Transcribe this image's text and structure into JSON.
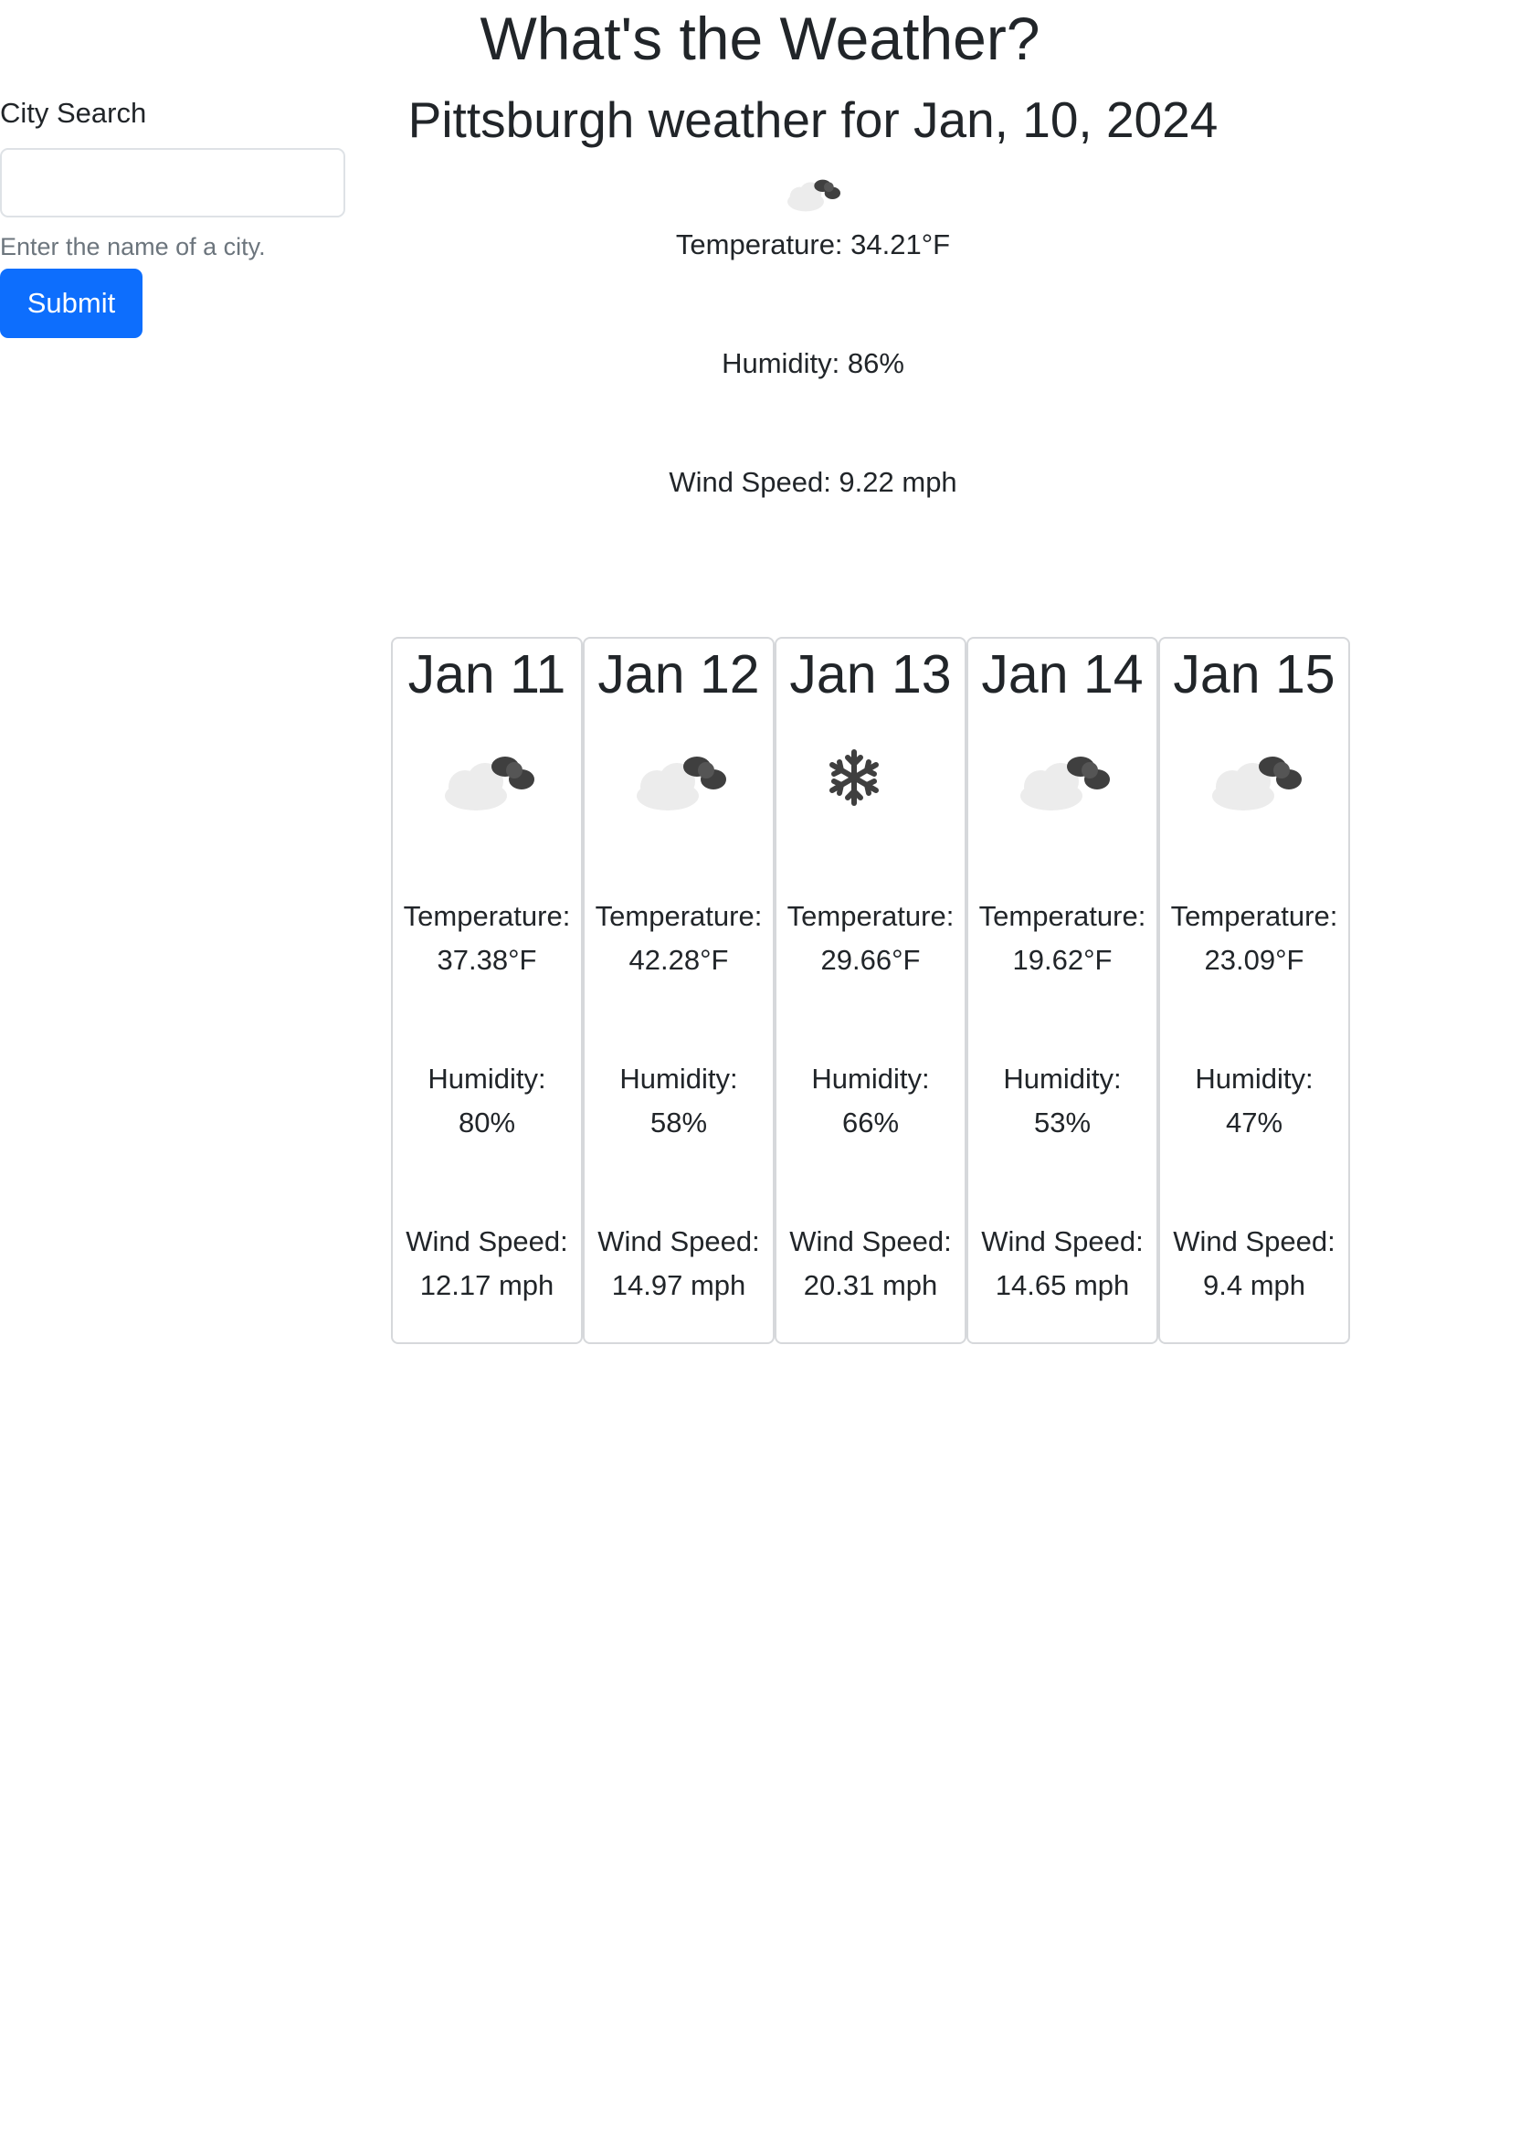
{
  "header": {
    "title": "What's the Weather?"
  },
  "search": {
    "label": "City Search",
    "value": "",
    "placeholder": "",
    "help": "Enter the name of a city.",
    "submit_label": "Submit"
  },
  "current": {
    "title": "Pittsburgh weather for Jan, 10, 2024",
    "icon": "cloudy-icon",
    "temperature": "Temperature: 34.21°F",
    "humidity": "Humidity: 86%",
    "wind": "Wind Speed: 9.22 mph"
  },
  "forecast": [
    {
      "date": "Jan 11",
      "icon": "cloudy-icon",
      "temp_label": "Temperature:",
      "temp": "37.38°F",
      "hum_label": "Humidity:",
      "hum": "80%",
      "wind_label": "Wind Speed:",
      "wind": "12.17 mph"
    },
    {
      "date": "Jan 12",
      "icon": "cloudy-icon",
      "temp_label": "Temperature:",
      "temp": "42.28°F",
      "hum_label": "Humidity:",
      "hum": "58%",
      "wind_label": "Wind Speed:",
      "wind": "14.97 mph"
    },
    {
      "date": "Jan 13",
      "icon": "snow-icon",
      "temp_label": "Temperature:",
      "temp": "29.66°F",
      "hum_label": "Humidity:",
      "hum": "66%",
      "wind_label": "Wind Speed:",
      "wind": "20.31 mph"
    },
    {
      "date": "Jan 14",
      "icon": "cloudy-icon",
      "temp_label": "Temperature:",
      "temp": "19.62°F",
      "hum_label": "Humidity:",
      "hum": "53%",
      "wind_label": "Wind Speed:",
      "wind": "14.65 mph"
    },
    {
      "date": "Jan 15",
      "icon": "cloudy-icon",
      "temp_label": "Temperature:",
      "temp": "23.09°F",
      "hum_label": "Humidity:",
      "hum": "47%",
      "wind_label": "Wind Speed:",
      "wind": "9.4 mph"
    }
  ],
  "colors": {
    "accent": "#0d6efd",
    "text": "#212529",
    "muted": "#6c757d",
    "border": "#d6d8db"
  }
}
